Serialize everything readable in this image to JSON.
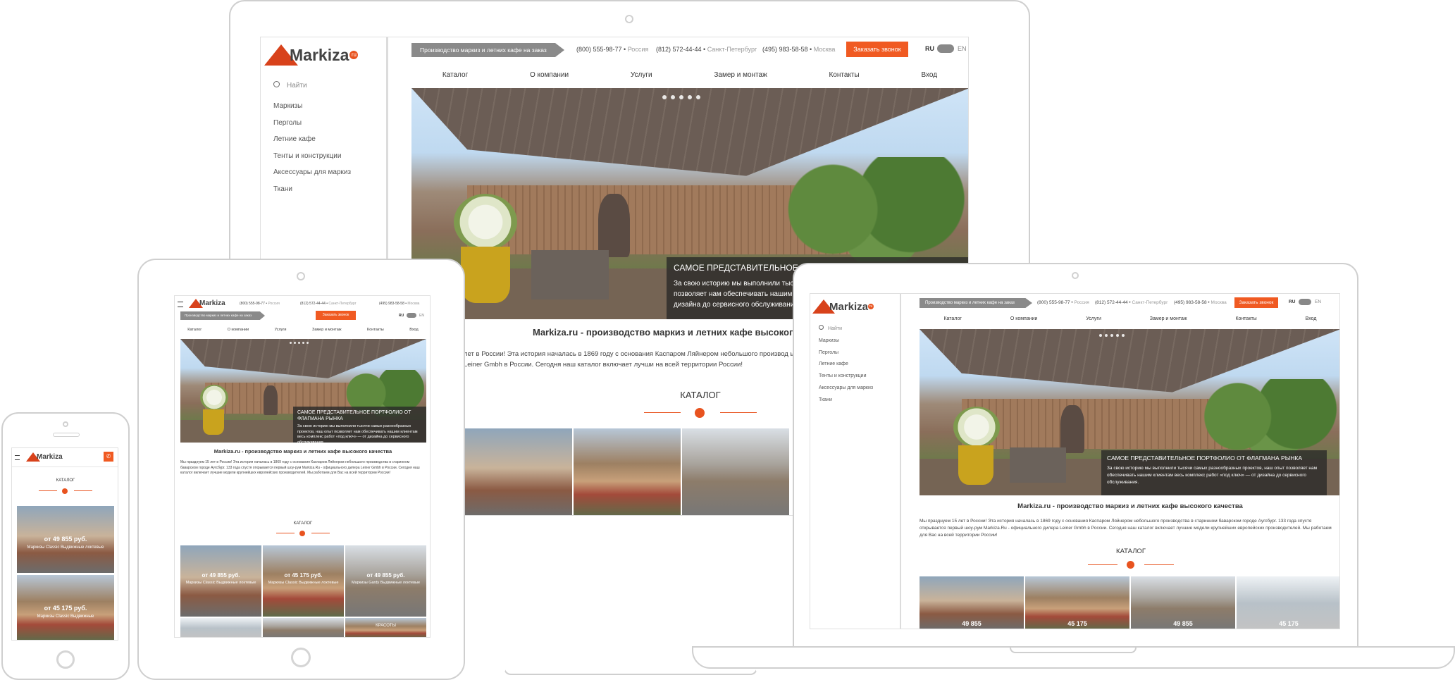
{
  "colors": {
    "accent": "#f05a22",
    "slogan_bg": "#8a8a8a",
    "caption_bg": "#282828",
    "device_frame": "#cfcfcf"
  },
  "site": {
    "logo_text": "Markiza",
    "logo_badge": "ru",
    "search_placeholder": "Найти",
    "menu": [
      "Маркизы",
      "Перголы",
      "Летние кафе",
      "Тенты и конструкции",
      "Аксессуары для маркиз",
      "Ткани"
    ],
    "slogan": "Производство маркиз и летних кафе на заказ",
    "phones": [
      {
        "number": "(800) 555-98-77",
        "city": "Россия"
      },
      {
        "number": "(812) 572-44-44",
        "city": "Санкт-Петербург"
      },
      {
        "number": "(495) 983-58-58",
        "city": "Москва"
      }
    ],
    "call_button": "Заказать звонок",
    "lang_ru": "RU",
    "lang_en": "EN",
    "nav": [
      "Каталог",
      "О компании",
      "Услуги",
      "Замер и монтаж",
      "Контакты",
      "Вход"
    ],
    "hero_caption_title": "САМОЕ ПРЕДСТАВИТЕЛЬНОЕ ПОРТФОЛИО ОТ ФЛАГМАНА РЫНКА",
    "hero_caption_text": "За свою историю мы выполнили тысячи самых разнообразных проектов, наш опыт позволяет нам обеспечивать нашим клиентам весь комплекс работ «под ключ» — от дизайна до сервисного обслуживания.",
    "desktop_caption_title": "САМОЕ ПРЕДСТАВИТЕЛЬНОЕ ПОРТФОЛИО ОТ ФЛАГМАНА РЫНКА",
    "desktop_caption_text": "За свою историю мы выполнили тысячи самых разнообразных проектов, наш опыт позволяет нам обеспечивать нашим клиентам весь комплекс работ «под ключ» — от дизайна до сервисного обслуживания.",
    "page_title": "Markiza.ru - производство маркиз и летних кафе высокого качества",
    "paragraph": "Мы празднуем 15 лет в России! Эта история началась в 1869 году с основания Каспаром Ляйнером небольшого производства в старинном баварском городе Аугсбург. 133 года спустя открывается первый шоу-рум Markiza.Ru - официального дилера Leiner Gmbh в России. Сегодня наш каталог включает лучшие модели крупнейших европейских производителей. Мы работаем для Вас на всей территории России!",
    "desktop_paragraph": "лет в России! Эта история началась в 1869 году с основания Каспаром Ляйнером небольшого производ ый шоу-рум Markiza.Ru - официального дилера Leiner Gmbh в России. Сегодня наш каталог включает лучши на всей территории России!",
    "catalog_title": "КАТАЛОГ",
    "products": [
      {
        "price": "от 49 855 руб.",
        "name": "Маркизы Classic Выдвижные локтевые"
      },
      {
        "price": "от 45 175 руб.",
        "name": "Маркизы Classic Выдвижные локтевые"
      },
      {
        "price": "от 49 855 руб.",
        "name": "Маркизы Gardy Выдвижные локтевые"
      }
    ],
    "phone_products": [
      {
        "price": "от 49 855 руб.",
        "name": "Маркизы Classic Выдвижные локтевые"
      },
      {
        "price": "от 45 175 руб.",
        "name": "Маркизы Classic Выдвижные"
      }
    ],
    "laptop_prices": [
      "49 855",
      "45 175",
      "49 855",
      "45 175"
    ],
    "tablet_bottom_sign": "КРАСОТЫ"
  }
}
